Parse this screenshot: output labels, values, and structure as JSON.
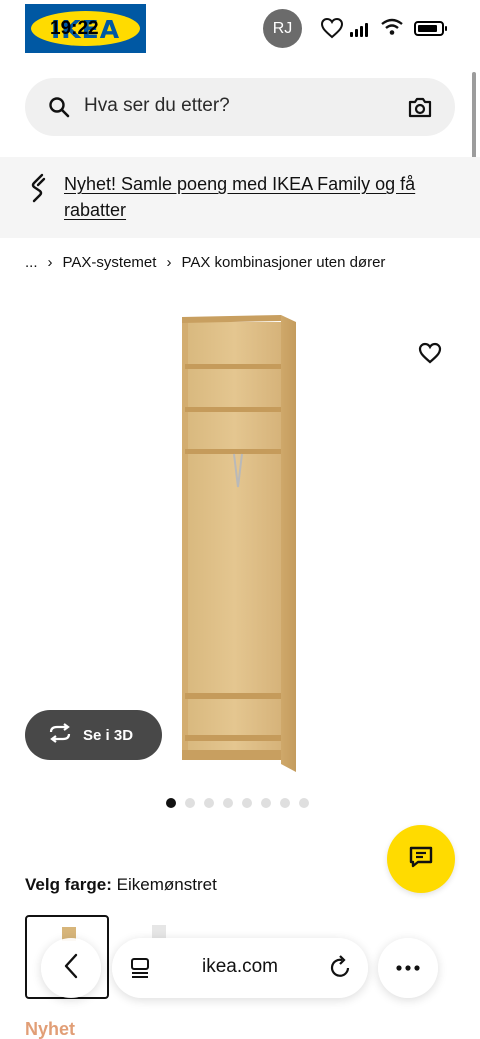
{
  "status_bar": {
    "logo_text": "IKEA",
    "time": "19:22",
    "avatar_initials": "RJ",
    "battery_level": 0.85
  },
  "search": {
    "placeholder": "Hva ser du etter?"
  },
  "promo": {
    "text": "Nyhet! Samle poeng med IKEA Family og få rabatter"
  },
  "breadcrumb": {
    "ellipsis": "...",
    "items": [
      "PAX-systemet",
      "PAX kombinasjoner uten dører"
    ]
  },
  "product": {
    "view_3d_label": "Se i 3D",
    "image_count": 8,
    "active_image": 1,
    "color_label": "Velg farge:",
    "color_value": "Eikemønstret",
    "badge": "Nyhet"
  },
  "browser": {
    "url": "ikea.com"
  },
  "colors": {
    "ikea_blue": "#0058a3",
    "ikea_yellow": "#ffdb00",
    "new_orange": "#ca5008"
  }
}
